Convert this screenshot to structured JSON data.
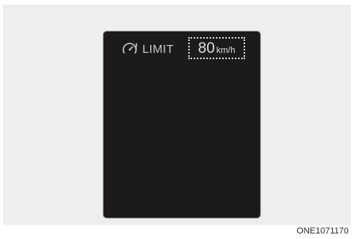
{
  "display": {
    "limit_label": "LIMIT",
    "speed_value": "80",
    "speed_unit": "km/h",
    "icon": "speed-limiter-icon"
  },
  "figure_code": "ONE1071170",
  "colors": {
    "page_background": "#eeeeee",
    "display_background": "#1c1a1b",
    "text": "#c8c8c8"
  }
}
